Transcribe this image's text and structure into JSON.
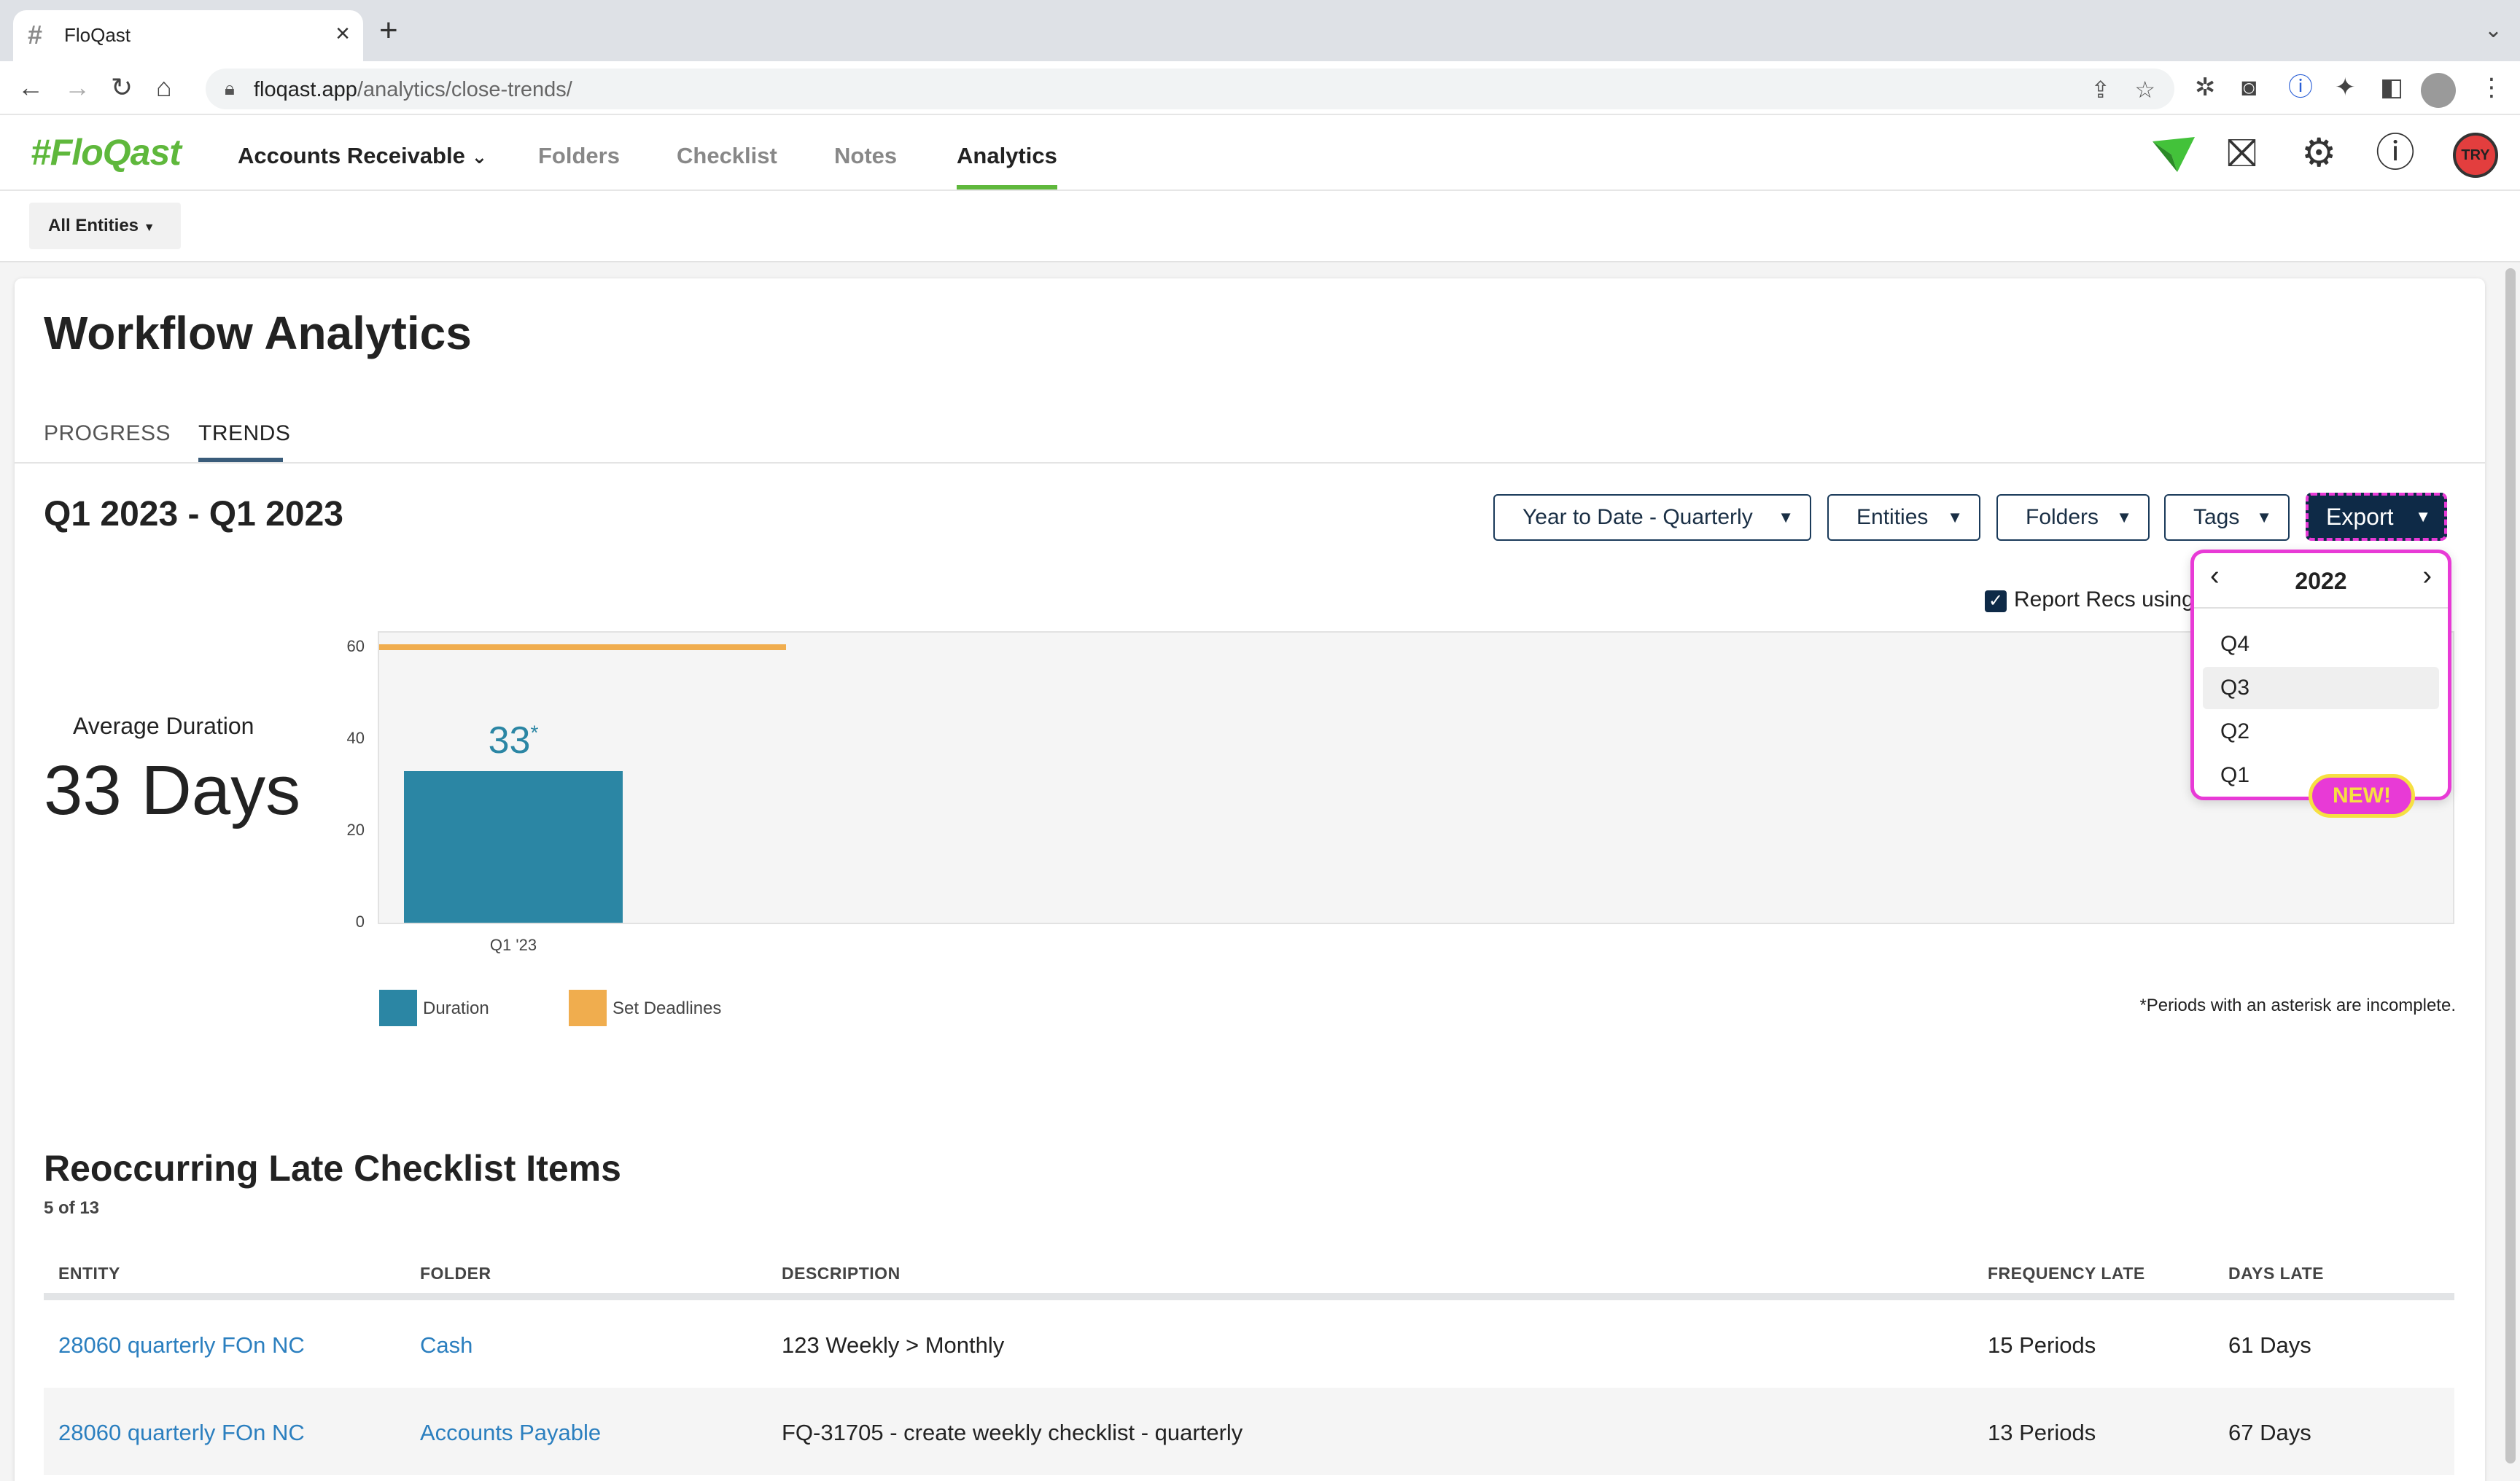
{
  "browser": {
    "tab_title": "FloQast",
    "tab_favicon": "#",
    "url_host": "floqast.app",
    "url_path": "/analytics/close-trends/"
  },
  "header": {
    "logo": "#FloQast",
    "accounts_menu": "Accounts Receivable",
    "nav": [
      "Folders",
      "Checklist",
      "Notes",
      "Analytics"
    ],
    "user_initials": "TRY"
  },
  "entity_selector": "All Entities",
  "page": {
    "title": "Workflow Analytics",
    "tabs": [
      "PROGRESS",
      "TRENDS"
    ],
    "period": "Q1 2023 - Q1 2023",
    "filters": [
      "Year to Date - Quarterly",
      "Entities",
      "Folders",
      "Tags"
    ],
    "export_label": "Export",
    "report_recs_label": "Report Recs using",
    "average_duration_label": "Average Duration",
    "average_duration_value": "33 Days",
    "asterisk_note": "*Periods with an asterisk are incomplete."
  },
  "chart_data": {
    "type": "bar",
    "categories": [
      "Q1 '23"
    ],
    "series": [
      {
        "name": "Duration",
        "values": [
          33
        ],
        "color": "#2b86a4"
      },
      {
        "name": "Set Deadlines",
        "values": [
          60
        ],
        "color": "#f0ad4e"
      }
    ],
    "bar_labels": [
      "33*"
    ],
    "yticks": [
      0,
      20,
      40,
      60
    ],
    "ylim": [
      0,
      60
    ],
    "grid": false,
    "legend_position": "bottom-left"
  },
  "export_dropdown": {
    "year": "2022",
    "quarters": [
      "Q4",
      "Q3",
      "Q2",
      "Q1"
    ],
    "highlighted": "Q3",
    "badge": "NEW!"
  },
  "late_items": {
    "title": "Reoccurring Late Checklist Items",
    "count": "5 of 13",
    "columns": [
      "ENTITY",
      "FOLDER",
      "DESCRIPTION",
      "FREQUENCY LATE",
      "DAYS LATE"
    ],
    "rows": [
      {
        "entity": "28060 quarterly FOn NC",
        "folder": "Cash",
        "description": "123 Weekly > Monthly",
        "frequency": "15 Periods",
        "days": "61 Days"
      },
      {
        "entity": "28060 quarterly FOn NC",
        "folder": "Accounts Payable",
        "description": "FQ-31705 - create weekly checklist - quarterly",
        "frequency": "13 Periods",
        "days": "67 Days"
      }
    ]
  },
  "colors": {
    "brand_green": "#5fb83c",
    "navy": "#0e2a47",
    "highlight_magenta": "#e83ad6",
    "badge_yellow": "#f6e042",
    "link_blue": "#2b7fbf"
  }
}
